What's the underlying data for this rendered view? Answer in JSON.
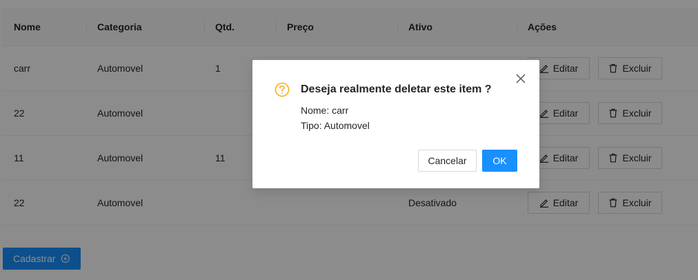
{
  "table": {
    "columns": [
      "Nome",
      "Categoria",
      "Qtd.",
      "Preço",
      "Ativo",
      "Ações"
    ],
    "rows": [
      {
        "nome": "carr",
        "categoria": "Automovel",
        "qtd": "1",
        "preco": "",
        "ativo": ""
      },
      {
        "nome": "22",
        "categoria": "Automovel",
        "qtd": "",
        "preco": "",
        "ativo": ""
      },
      {
        "nome": "11",
        "categoria": "Automovel",
        "qtd": "11",
        "preco": "",
        "ativo": ""
      },
      {
        "nome": "22",
        "categoria": "Automovel",
        "qtd": "",
        "preco": "",
        "ativo": "Desativado"
      }
    ],
    "edit_label": "Editar",
    "delete_label": "Excluir"
  },
  "cadastrar_label": "Cadastrar",
  "modal": {
    "title": "Deseja realmente deletar este item ?",
    "line1": "Nome: carr",
    "line2": "Tipo: Automovel",
    "cancel_label": "Cancelar",
    "ok_label": "OK"
  },
  "icons": {
    "question": "question-circle-icon",
    "close": "close-icon",
    "edit": "edit-icon",
    "delete": "delete-icon",
    "add": "plus-circle-icon"
  },
  "colors": {
    "primary": "#1890ff",
    "warning": "#faad14",
    "overlay": "rgba(0,0,0,0.45)"
  }
}
